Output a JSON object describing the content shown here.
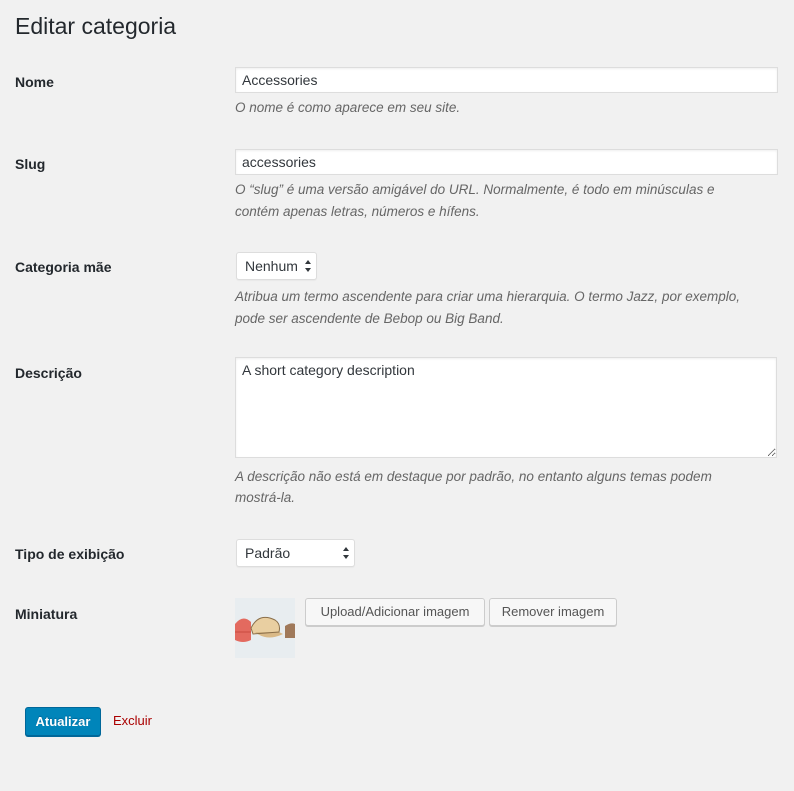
{
  "page": {
    "title": "Editar categoria"
  },
  "fields": {
    "name": {
      "label": "Nome",
      "value": "Accessories",
      "description": "O nome é como aparece em seu site."
    },
    "slug": {
      "label": "Slug",
      "value": "accessories",
      "description_line1": "O “slug” é uma versão amigável do URL. Normalmente, é todo em minúsculas e",
      "description_line2": "contém apenas letras, números e hífens."
    },
    "parent": {
      "label": "Categoria mãe",
      "selected": "Nenhum",
      "description_line1": "Atribua um termo ascendente para criar uma hierarquia. O termo Jazz, por exemplo,",
      "description_line2": "pode ser ascendente de Bebop ou Big Band."
    },
    "description": {
      "label": "Descrição",
      "value": "A short category description",
      "description_line1": "A descrição não está em destaque por padrão, no entanto alguns temas podem",
      "description_line2": "mostrá-la."
    },
    "display_type": {
      "label": "Tipo de exibição",
      "selected": "Padrão"
    },
    "thumbnail": {
      "label": "Miniatura",
      "upload_button": "Upload/Adicionar imagem",
      "remove_button": "Remover imagem"
    }
  },
  "actions": {
    "update_button": "Atualizar",
    "delete_link": "Excluir"
  },
  "colors": {
    "background": "#f1f1f1",
    "primary": "#0085ba",
    "delete": "#aa0000"
  }
}
